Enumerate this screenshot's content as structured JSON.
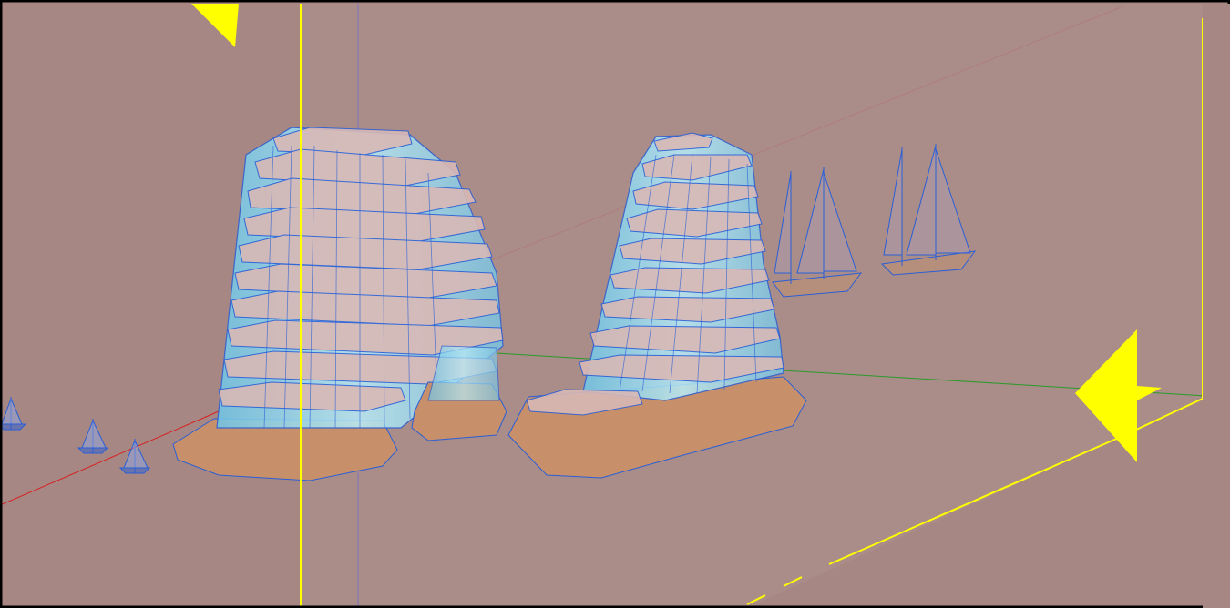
{
  "viewport": {
    "background": "#a68784",
    "section_plane_color": "#ffff00",
    "model_edge_color": "#2a5fd6",
    "glass_fill": "#8fd4ec",
    "slab_fill": "#d8b9b6",
    "base_fill": "#c7906a",
    "axis_red": "#d92020",
    "axis_green": "#2a9a2a",
    "axis_blue": "#4a4ad0"
  },
  "scene": {
    "models": [
      "tower-left",
      "tower-right",
      "sailboat-1",
      "sailboat-2",
      "small-boat-1",
      "small-boat-2",
      "small-boat-3"
    ],
    "section_planes": [
      "section-plane-front",
      "section-plane-right"
    ],
    "icons": [
      "section-arrow-top-left",
      "section-arrow-right"
    ]
  }
}
